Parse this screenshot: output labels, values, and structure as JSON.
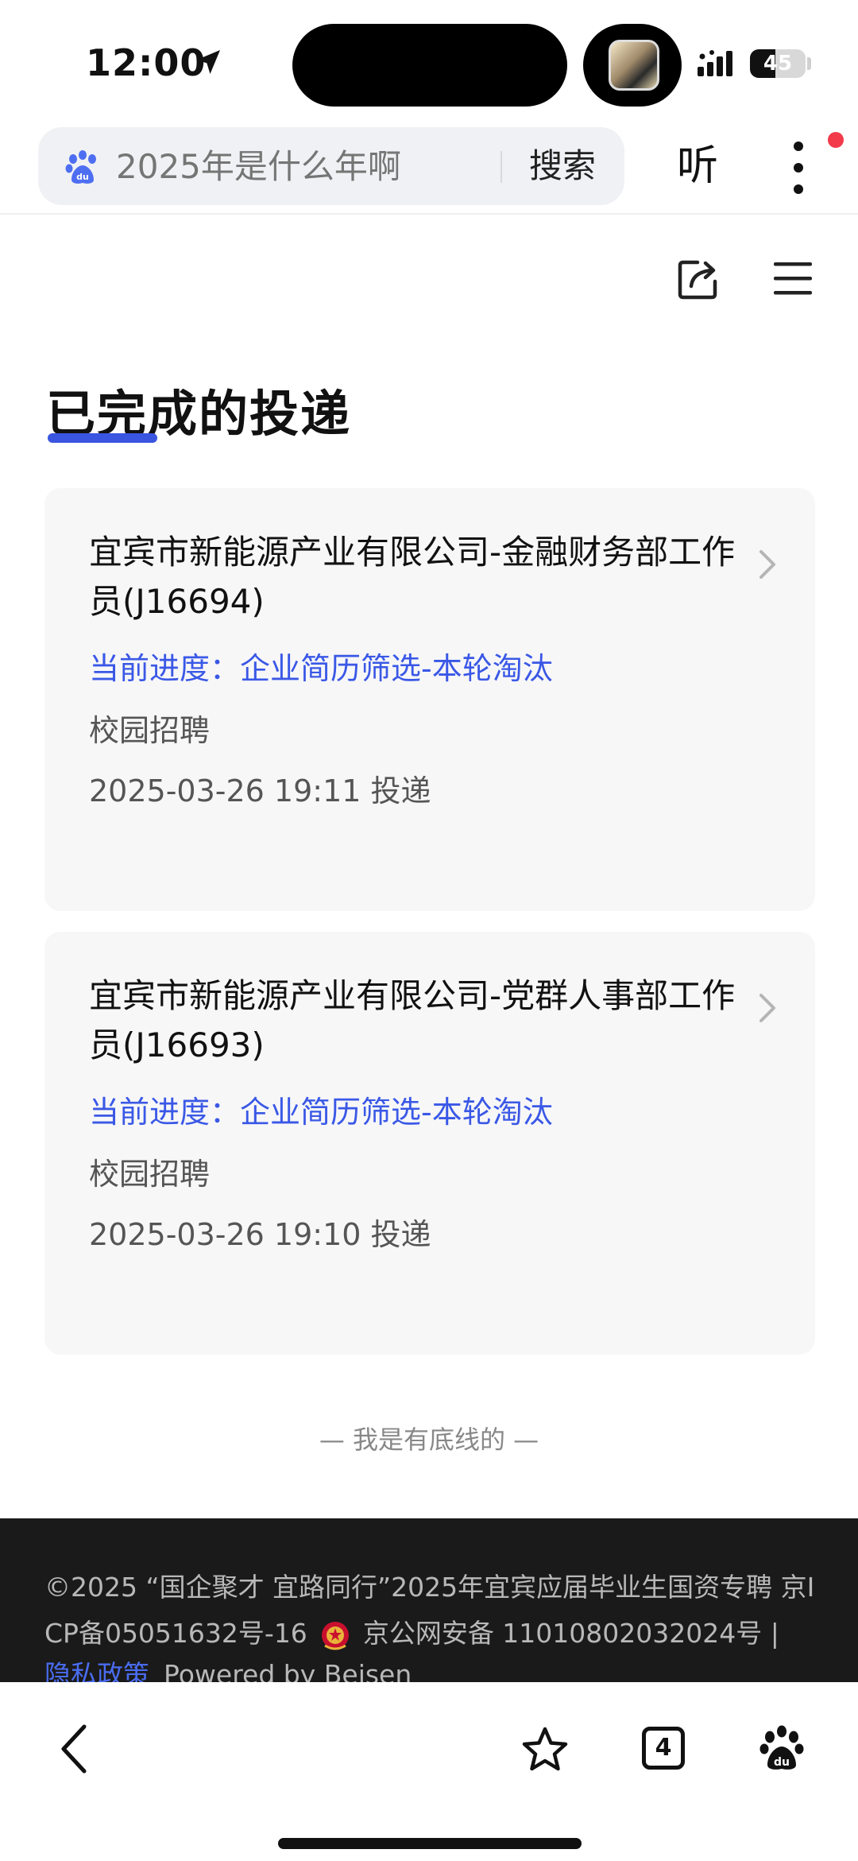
{
  "status_bar": {
    "time": "12:00",
    "battery": "45",
    "battery_level": 0.45
  },
  "header": {
    "search_placeholder": "2025年是什么年啊",
    "search_button": "搜索",
    "listen_button": "听"
  },
  "page": {
    "title": "已完成的投递"
  },
  "applications": [
    {
      "title": "宜宾市新能源产业有限公司-金融财务部工作员(J16694)",
      "progress": "当前进度：企业简历筛选-本轮淘汰",
      "type": "校园招聘",
      "date": "2025-03-26 19:11 投递"
    },
    {
      "title": "宜宾市新能源产业有限公司-党群人事部工作员(J16693)",
      "progress": "当前进度：企业简历筛选-本轮淘汰",
      "type": "校园招聘",
      "date": "2025-03-26 19:10 投递"
    }
  ],
  "bottom_line": "— 我是有底线的 —",
  "footer": {
    "line1": "©2025 “国企聚才 宜路同行”2025年宜宾应届毕业生国资专聘  京I",
    "line2_icp": "CP备05051632号-16",
    "line2_police": "京公网安备 11010802032024号 |",
    "privacy": "隐私政策",
    "powered": "Powered by Beisen"
  },
  "bottom_nav": {
    "tab_count": "4"
  },
  "colors": {
    "accent": "#3a58e6",
    "footer_bg": "#1a1a1a",
    "card_bg": "#f7f7f8"
  },
  "icons": [
    "location-arrow-icon",
    "signal-icon",
    "battery-icon",
    "baidu-paw-icon",
    "more-vertical-icon",
    "share-icon",
    "menu-icon",
    "chevron-right-icon",
    "police-badge-icon",
    "back-icon",
    "star-icon",
    "tabs-icon"
  ]
}
